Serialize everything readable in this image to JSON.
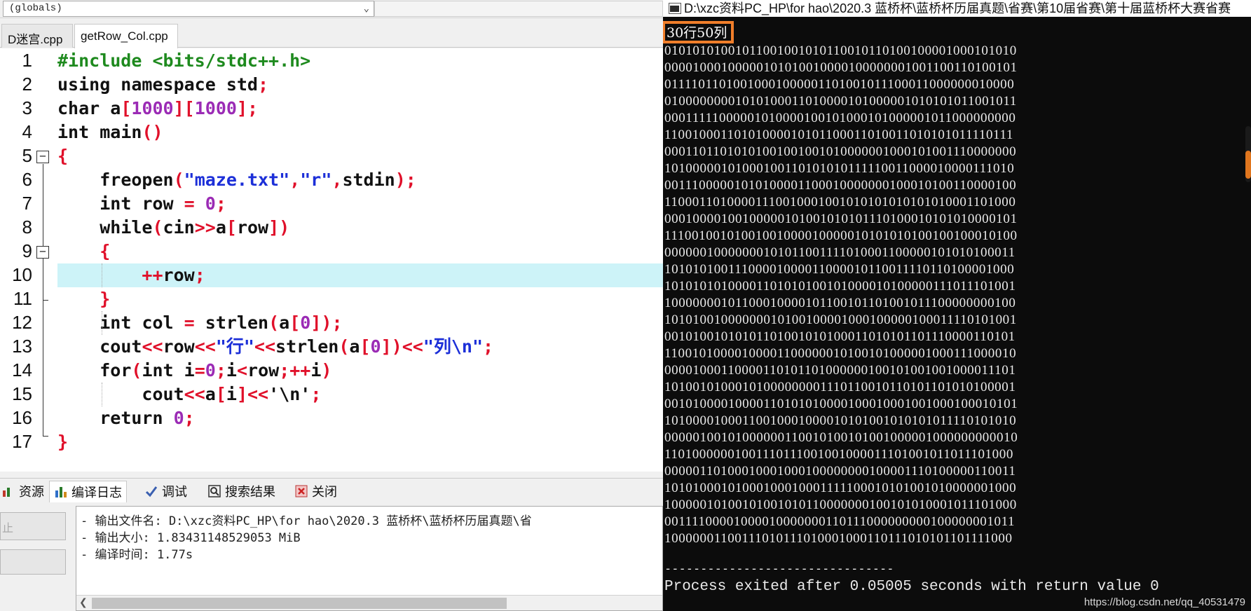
{
  "ide": {
    "scope_select": "(globals)",
    "file_tabs": [
      {
        "label": "D迷宫.cpp"
      },
      {
        "label": "getRow_Col.cpp"
      }
    ],
    "code_lines": [
      "1",
      "2",
      "3",
      "4",
      "5",
      "6",
      "7",
      "8",
      "9",
      "10",
      "11",
      "12",
      "13",
      "14",
      "15",
      "16",
      "17"
    ],
    "bottom_tabs": [
      {
        "label": "资源",
        "icon": "bar-chart-icon"
      },
      {
        "label": "编译日志",
        "icon": "bar-chart-icon"
      },
      {
        "label": "调试",
        "icon": "check-icon"
      },
      {
        "label": "搜索结果",
        "icon": "search-icon"
      },
      {
        "label": "关闭",
        "icon": "close-icon"
      }
    ],
    "side_buttons": [
      "止",
      ""
    ],
    "log_lines": [
      "- 输出文件名: D:\\xzc资料PC_HP\\for hao\\2020.3 蓝桥杯\\蓝桥杯历届真题\\省",
      "- 输出大小: 1.83431148529053 MiB",
      "- 编译时间: 1.77s"
    ]
  },
  "code": {
    "l1_pp": "#include <bits/stdc++.h>",
    "l2_kw": "using namespace std",
    "l3_kw": "char",
    "l3_id": "a",
    "l3_num1": "1000",
    "l3_num2": "1000",
    "l4_kw": "int",
    "l4_id": "main",
    "l6_fn": "freopen",
    "l6_s1": "\"maze.txt\"",
    "l6_s2": "\"r\"",
    "l6_id": "stdin",
    "l7_kw": "int",
    "l7_id": "row",
    "l7_num": "0",
    "l8_kw": "while",
    "l8_id1": "cin",
    "l8_id2": "a",
    "l8_id3": "row",
    "l10_id": "row",
    "l12_kw": "int",
    "l12_id1": "col",
    "l12_fn": "strlen",
    "l12_id2": "a",
    "l12_num": "0",
    "l13_id1": "cout",
    "l13_id2": "row",
    "l13_s1": "\"行\"",
    "l13_fn": "strlen",
    "l13_id3": "a",
    "l13_num": "0",
    "l13_s2": "\"列\\n\"",
    "l14_kw1": "for",
    "l14_kw2": "int",
    "l14_id1": "i",
    "l14_num": "0",
    "l14_id2": "i",
    "l14_id3": "row",
    "l14_id4": "i",
    "l15_id1": "cout",
    "l15_id2": "a",
    "l15_id3": "i",
    "l15_s": "'\\n'",
    "l16_kw": "return",
    "l16_num": "0"
  },
  "console": {
    "title": "D:\\xzc资料PC_HP\\for hao\\2020.3 蓝桥杯\\蓝桥杯历届真题\\省赛\\第10届省赛\\第十届蓝桥杯大赛省赛",
    "header": "30行50列",
    "maze": [
      "01010101001011001001010110010110100100001000101010",
      "00001000100000101010010000100000001001100110100101",
      "01111011010010001000001101001011100011000000010000",
      "01000000001010100011010000101000001010101011001011",
      "00011111000001010000100101000101000001011000000000",
      "11001000110101000010101100011010011010101011110111",
      "00011011010101001001001010000001000101001110000000",
      "10100000101000100110101010111110011000010000111010",
      "00111000001010100001100010000000100010100110000100",
      "11000110100001110010001001010101010101010001101000",
      "00010000100100000101001010101110100010101010000101",
      "11100100101001001000010000010101010100100100010100",
      "00000010000000101011001111010001100000101010100011",
      "10101010011100001000011000010110011110110100001000",
      "10101010100001101010100101000010100000111011101001",
      "10000000101100010000101100101101001011100000000100",
      "10101001000000010100100001000100000100011110101001",
      "00101001010101101001010100011010101101110000110101",
      "11001010000100001100000010100101000001000111000010",
      "00001000110000110101101000000100101001001000011101",
      "10100101000101000000001110110010110101101010100001",
      "00101000010000110101010000100010001001000100010101",
      "10100001000110010001000010101001010101011110101010",
      "00000100101000000110010100101001000001000000000010",
      "11010000001001110111001001000011101001011011101000",
      "00000110100010001000100000000100001110100000110011",
      "10101000101000100010001111100010101001010000001000",
      "10000010100101001010110000000100101010001011101000",
      "00111100001000010000000110111000000000100000001011",
      "10000001100111010111010001000110111010101101111000"
    ],
    "separator": "--------------------------------",
    "exit_message": "Process exited after 0.05005 seconds with return value 0",
    "watermark": "https://blog.csdn.net/qq_40531479"
  }
}
